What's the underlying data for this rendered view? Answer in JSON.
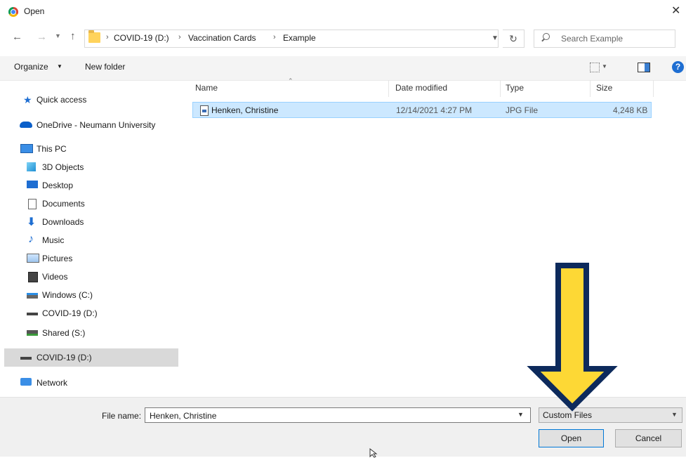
{
  "window": {
    "title": "Open",
    "close_glyph": "✕"
  },
  "address": {
    "crumbs": [
      "COVID-19 (D:)",
      "Vaccination Cards",
      "Example"
    ],
    "separator": "›",
    "search_placeholder": "Search Example"
  },
  "toolbar": {
    "organize": "Organize",
    "new_folder": "New folder",
    "help": "?"
  },
  "nav": {
    "items": [
      {
        "label": "Quick access",
        "icon": "star-icon"
      },
      {
        "label": "OneDrive - Neumann University",
        "icon": "cloud-icon"
      },
      {
        "label": "This PC",
        "icon": "monitor-icon"
      },
      {
        "label": "3D Objects",
        "icon": "cube-icon"
      },
      {
        "label": "Desktop",
        "icon": "desktop-icon"
      },
      {
        "label": "Documents",
        "icon": "document-icon"
      },
      {
        "label": "Downloads",
        "icon": "download-arrow-icon"
      },
      {
        "label": "Music",
        "icon": "music-note-icon"
      },
      {
        "label": "Pictures",
        "icon": "picture-icon"
      },
      {
        "label": "Videos",
        "icon": "film-icon"
      },
      {
        "label": "Windows (C:)",
        "icon": "windows-drive-icon"
      },
      {
        "label": "COVID-19 (D:)",
        "icon": "drive-icon"
      },
      {
        "label": "Shared (S:)",
        "icon": "network-drive-icon"
      },
      {
        "label": "COVID-19 (D:)",
        "icon": "drive-icon"
      },
      {
        "label": "Network",
        "icon": "network-icon"
      }
    ]
  },
  "columns": {
    "name": "Name",
    "date": "Date modified",
    "type": "Type",
    "size": "Size"
  },
  "files": [
    {
      "name": "Henken, Christine",
      "date": "12/14/2021 4:27 PM",
      "type": "JPG File",
      "size": "4,248 KB"
    }
  ],
  "bottom": {
    "file_name_label": "File name:",
    "file_name_value": "Henken, Christine",
    "file_type": "Custom Files",
    "open": "Open",
    "cancel": "Cancel"
  },
  "colors": {
    "selection": "#cce8ff",
    "arrow_fill": "#fdd835",
    "arrow_outline": "#0d2a5c",
    "accent": "#0078d7"
  }
}
